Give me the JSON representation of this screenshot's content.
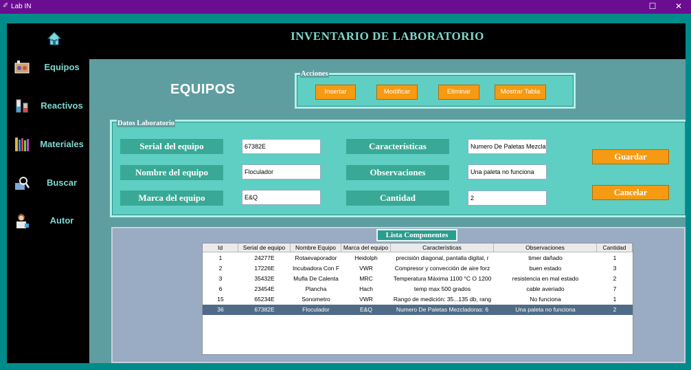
{
  "window": {
    "title": "Lab IN"
  },
  "header": {
    "title": "INVENTARIO DE LABORATORIO"
  },
  "sidebar": {
    "items": [
      {
        "label": "Equipos"
      },
      {
        "label": "Reactivos"
      },
      {
        "label": "Materiales"
      },
      {
        "label": "Buscar"
      },
      {
        "label": "Autor"
      }
    ]
  },
  "page": {
    "title": "EQUIPOS"
  },
  "acciones": {
    "legend": "Acciones",
    "insertar": "Insertar",
    "modificar": "Modificar",
    "eliminar": "Eliminar",
    "mostrar": "Mostrar Tabla"
  },
  "datos": {
    "legend": "Datos Laboratorio",
    "serial_label": "Serial del equipo",
    "serial_value": "67382E",
    "nombre_label": "Nombre del equipo",
    "nombre_value": "Floculador",
    "marca_label": "Marca del equipo",
    "marca_value": "E&Q",
    "caracteristicas_label": "Características",
    "caracteristicas_value": "Numero De Paletas Mezcladoras: 6",
    "observaciones_label": "Observaciones",
    "observaciones_value": "Una paleta no funciona",
    "cantidad_label": "Cantidad",
    "cantidad_value": "2",
    "guardar": "Guardar",
    "cancelar": "Cancelar"
  },
  "lista": {
    "legend": "Lista Componentes",
    "columns": [
      "Id",
      "Serial de equipo",
      "Nombre Equipo",
      "Marca del equipo",
      "Características",
      "Observaciones",
      "Cantidad"
    ],
    "rows": [
      [
        "1",
        "24277E",
        "Rotaevaporador",
        "Heidolph",
        "precisión diagonal, pantalla digital, r",
        "timer dañado",
        "1"
      ],
      [
        "2",
        "17226E",
        "Incubadora Con F",
        "VWR",
        "Compresor y convección de aire forz",
        "buen estado",
        "3"
      ],
      [
        "3",
        "35432E",
        "Mufla De Calenta",
        "MRC",
        "Temperatura Máxima 1100 °C O 1200",
        "resistencia en mal estado",
        "2"
      ],
      [
        "6",
        "23454E",
        "Plancha",
        "Hach",
        "temp max 500 grados",
        "cable averiado",
        "7"
      ],
      [
        "15",
        "65234E",
        "Sonometro",
        "VWR",
        "Rango de medición: 35...135 db, rang",
        "No funciona",
        "1"
      ],
      [
        "36",
        "67382E",
        "Floculador",
        "E&Q",
        "Numero De Paletas Mezcladoras: 6",
        "Una paleta no funciona",
        "2"
      ]
    ],
    "selected_row": 5
  }
}
